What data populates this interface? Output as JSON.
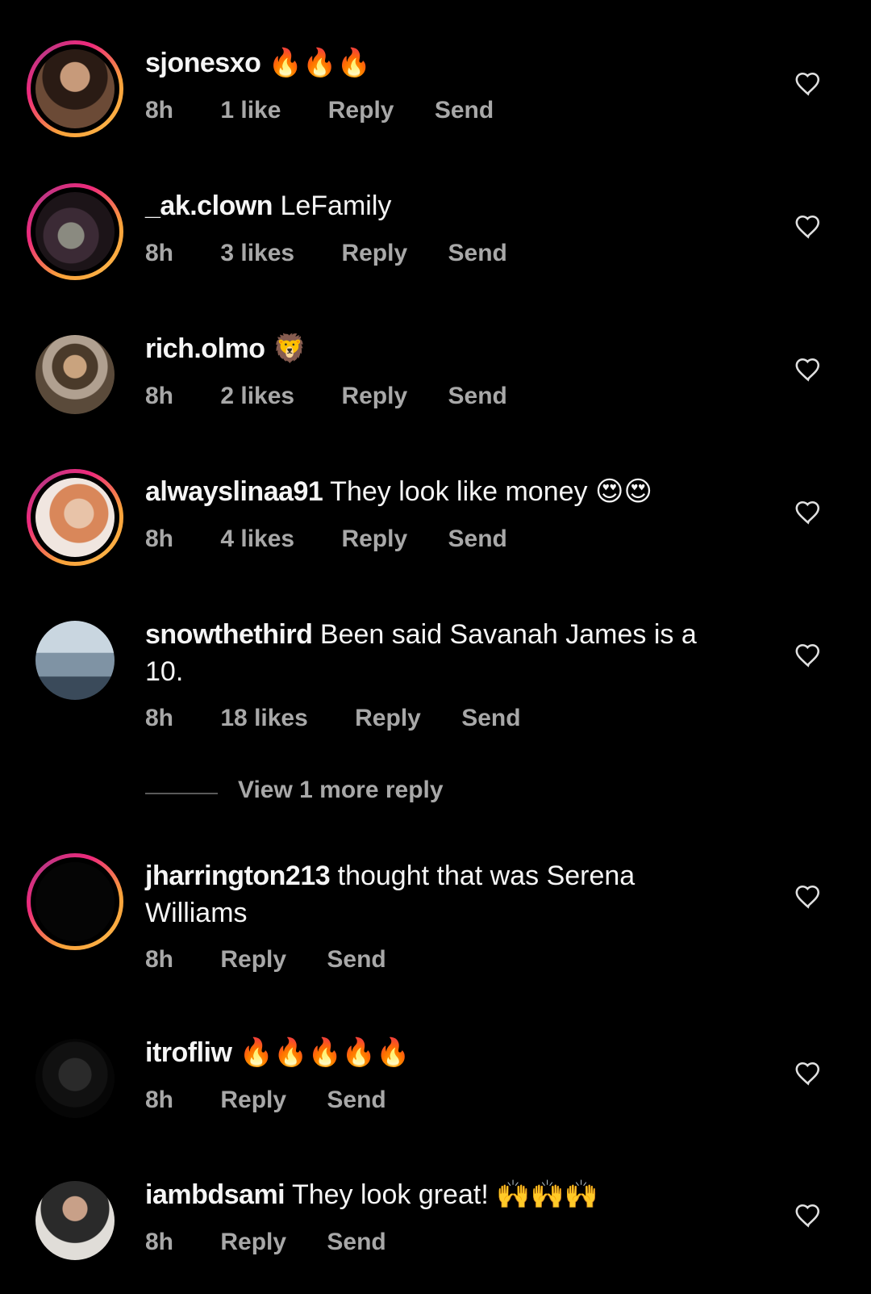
{
  "comments": [
    {
      "username": "sjonesxo",
      "text": "",
      "emoji": "🔥🔥🔥",
      "time": "8h",
      "likes": "1 like",
      "reply": "Reply",
      "send": "Send",
      "story_ring": true
    },
    {
      "username": "_ak.clown",
      "text": "LeFamily",
      "emoji": "",
      "time": "8h",
      "likes": "3 likes",
      "reply": "Reply",
      "send": "Send",
      "story_ring": true
    },
    {
      "username": "rich.olmo",
      "text": "",
      "emoji": "🦁",
      "time": "8h",
      "likes": "2 likes",
      "reply": "Reply",
      "send": "Send",
      "story_ring": false
    },
    {
      "username": "alwayslinaa91",
      "text": "They look like money",
      "emoji": "😍😍",
      "time": "8h",
      "likes": "4 likes",
      "reply": "Reply",
      "send": "Send",
      "story_ring": true
    },
    {
      "username": "snowthethird",
      "text": "Been said Savanah James is a",
      "text2": "10.",
      "emoji": "",
      "time": "8h",
      "likes": "18 likes",
      "reply": "Reply",
      "send": "Send",
      "story_ring": false
    },
    {
      "username": "jharrington213",
      "text": "thought that was Serena",
      "text2": "Williams",
      "emoji": "",
      "time": "8h",
      "likes": "",
      "reply": "Reply",
      "send": "Send",
      "story_ring": true
    },
    {
      "username": "itrofliw",
      "text": "",
      "emoji": "🔥🔥🔥🔥🔥",
      "time": "8h",
      "likes": "",
      "reply": "Reply",
      "send": "Send",
      "story_ring": false
    },
    {
      "username": "iambdsami",
      "text": "They look great!",
      "emoji": "🙌🙌🙌",
      "time": "8h",
      "likes": "",
      "reply": "Reply",
      "send": "Send",
      "story_ring": false
    }
  ],
  "view_more_replies": "View 1 more reply",
  "colors": {
    "background": "#000000",
    "text": "#f5f5f5",
    "meta": "#a8a8a8",
    "ring_start": "#f9a23a",
    "ring_end": "#c13584"
  }
}
